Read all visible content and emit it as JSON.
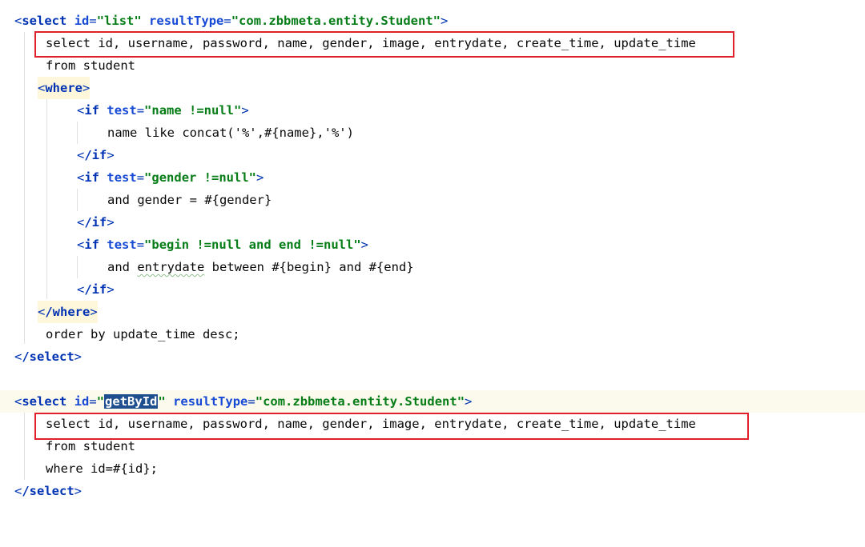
{
  "block1": {
    "open": {
      "tag": "select",
      "id_attr": "id",
      "id_val": "\"list\"",
      "rt_attr": "resultType",
      "rt_val": "\"com.zbbmeta.entity.Student\""
    },
    "sql_select": "select id, username, password, name, gender, image, entrydate, create_time, update_time",
    "sql_from": "from student",
    "where_tag": "where",
    "if1": {
      "tag": "if",
      "attr": "test",
      "val": "\"name !=null\"",
      "body": "name like concat('%',#{name},'%')",
      "close": "/if"
    },
    "if2": {
      "tag": "if",
      "attr": "test",
      "val": "\"gender !=null\"",
      "body": "and gender = #{gender}",
      "close": "/if"
    },
    "if3": {
      "tag": "if",
      "attr": "test",
      "val": "\"begin !=null and end !=null\"",
      "body_pre": "and ",
      "body_word": "entrydate",
      "body_post": " between #{begin} and #{end}",
      "close": "/if"
    },
    "where_close": "/where",
    "order": "order by update_time desc;",
    "close": "/select"
  },
  "block2": {
    "open": {
      "tag": "select",
      "id_attr": "id",
      "id_q1": "\"",
      "id_word": "getById",
      "id_q2": "\"",
      "rt_attr": "resultType",
      "rt_val": "\"com.zbbmeta.entity.Student\""
    },
    "sql_select": "select id, username, password, name, gender, image, entrydate, create_time, update_time",
    "sql_from": "from student",
    "sql_where": "where id=#{id};",
    "close": "/select"
  },
  "colors": {
    "tag": "#0033b3",
    "string": "#067d17",
    "highlight_box": "#e0202a",
    "current_line": "#fcfaed",
    "selection": "#1f4f8f"
  }
}
